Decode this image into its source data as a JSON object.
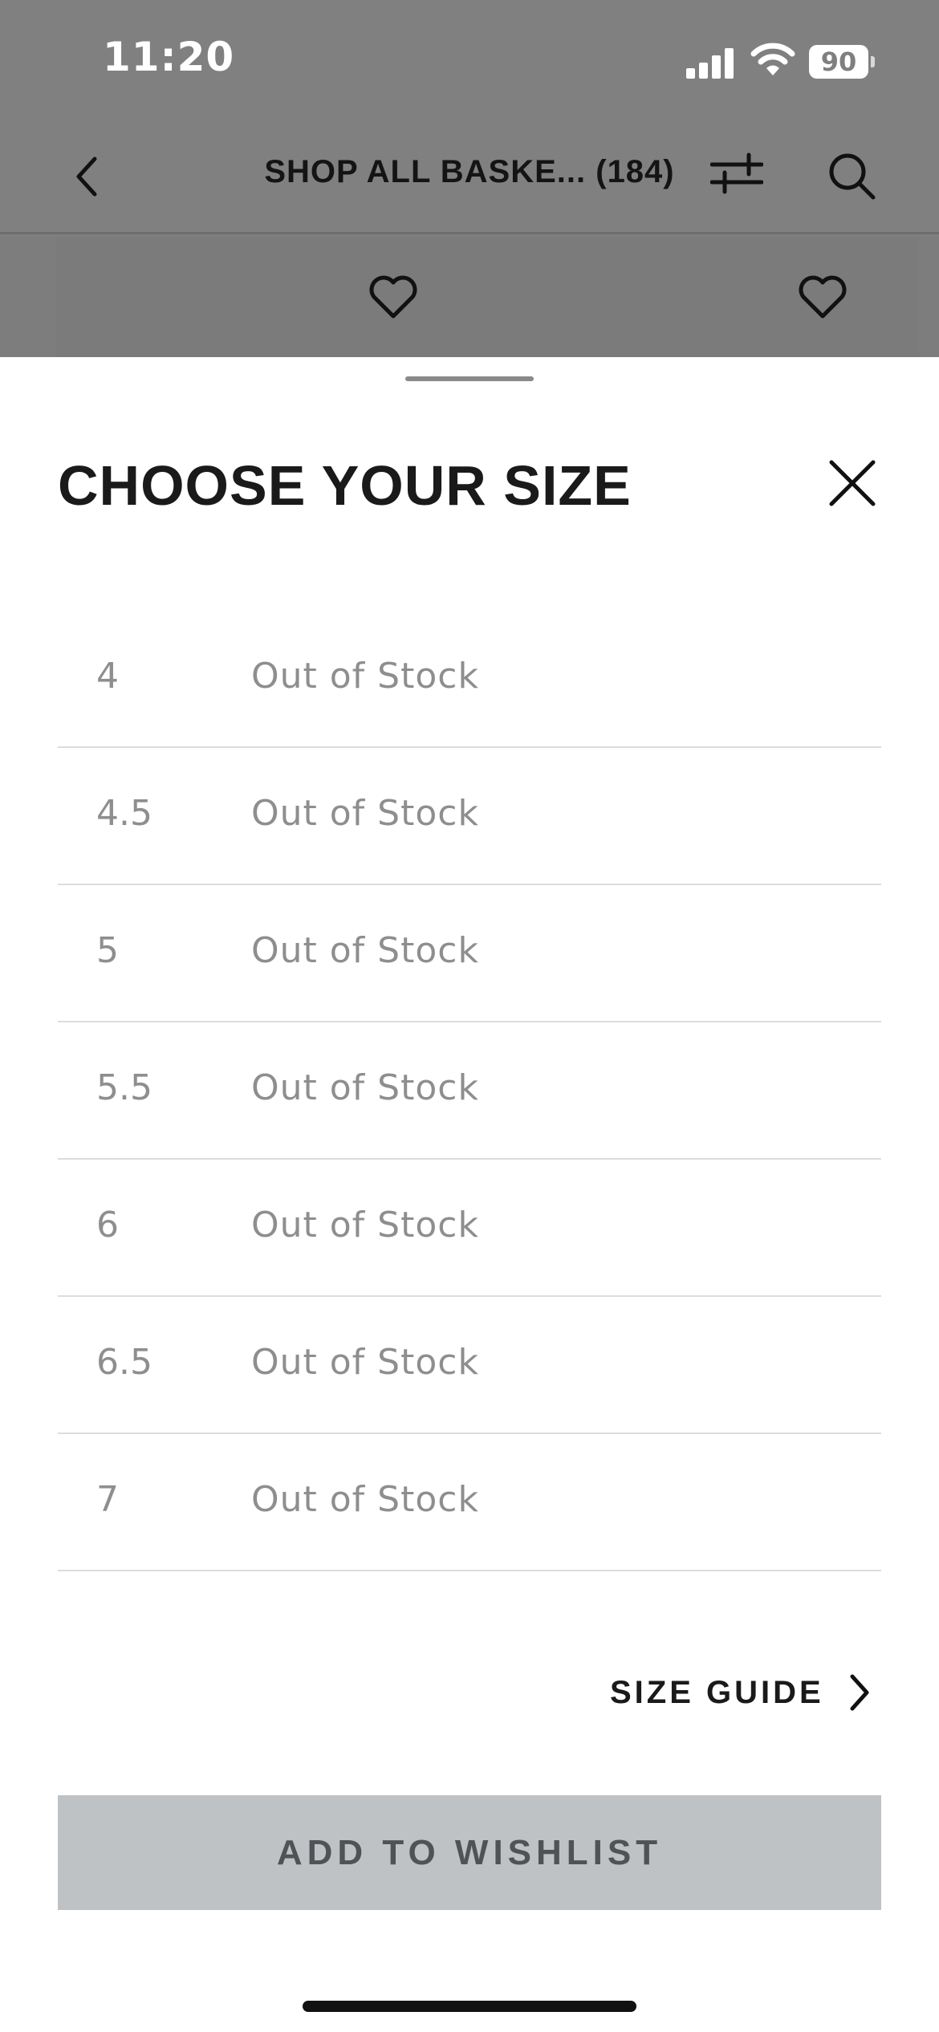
{
  "status_bar": {
    "time": "11:20",
    "battery": "90",
    "icons": [
      "signal-icon",
      "wifi-icon",
      "battery-icon"
    ]
  },
  "nav_bar": {
    "title": "SHOP ALL BASKE... (184)",
    "icons": [
      "back-icon",
      "filter-icon",
      "search-icon"
    ]
  },
  "product_strip": {
    "icons": [
      "heart-icon",
      "heart-icon"
    ]
  },
  "sheet": {
    "title": "CHOOSE YOUR SIZE",
    "sizes": [
      {
        "size": "4",
        "status": "Out of Stock"
      },
      {
        "size": "4.5",
        "status": "Out of Stock"
      },
      {
        "size": "5",
        "status": "Out of Stock"
      },
      {
        "size": "5.5",
        "status": "Out of Stock"
      },
      {
        "size": "6",
        "status": "Out of Stock"
      },
      {
        "size": "6.5",
        "status": "Out of Stock"
      },
      {
        "size": "7",
        "status": "Out of Stock"
      }
    ],
    "size_guide_label": "SIZE GUIDE",
    "wishlist_label": "ADD TO WISHLIST"
  },
  "colors": {
    "overlay_gray": "#7f7f7f",
    "sheet_bg": "#ffffff",
    "muted_text": "#8e8e8e",
    "button_bg": "#bfc2c4",
    "button_text": "#4f5356"
  }
}
